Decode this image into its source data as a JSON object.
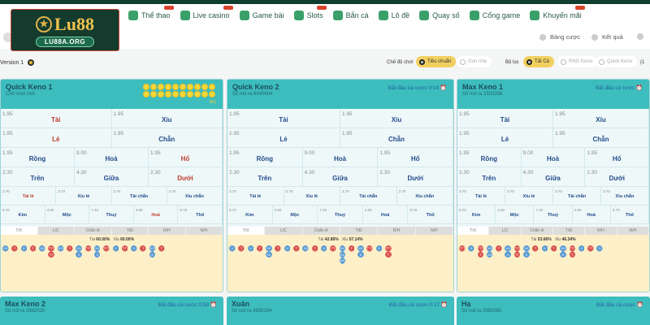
{
  "logo": {
    "text": "Lu88",
    "sub": "LU88A.ORG"
  },
  "nav": [
    {
      "label": "Thể thao",
      "badge": ""
    },
    {
      "label": "Live casino",
      "badge": ""
    },
    {
      "label": "Game bài",
      "badge": ""
    },
    {
      "label": "Slots",
      "badge": ""
    },
    {
      "label": "Bắn cá",
      "badge": ""
    },
    {
      "label": "Lô đề",
      "badge": ""
    },
    {
      "label": "Quay số",
      "badge": ""
    },
    {
      "label": "Cổng game",
      "badge": ""
    },
    {
      "label": "Khuyến mãi",
      "badge": ""
    }
  ],
  "sub": {
    "bet_board": "Bảng cược",
    "results": "Kết quả"
  },
  "filter": {
    "version": "Version 1",
    "mode_label": "Chế độ chơi",
    "modes": [
      "Tiêu chuẩn",
      "Gọn nhẹ"
    ],
    "filter_label": "Bộ lọc",
    "filters": [
      "Tất Cả",
      "RNG Keno",
      "Quick Keno"
    ],
    "extra": "(1"
  },
  "colors": {
    "header": "#3dbdbd",
    "tai": "#d9534f",
    "xiu": "#5b9bd5",
    "brand": "#143b2e"
  },
  "tabs": [
    "T/X",
    "L/C",
    "Chẵn lẻ",
    "T/Đ",
    "R/H",
    "N/H"
  ],
  "cards": [
    {
      "title": "Quick Keno 1",
      "subtitle": "Chờ lượt mới",
      "countdown": "",
      "sum": "903",
      "pct_tai_label": "Tài",
      "pct_tai": "60.00%",
      "pct_xiu_label": "Xỉu",
      "pct_xiu": "60.00%",
      "road": [
        "XX",
        "T",
        "X",
        "T",
        "XX",
        "TTTTT",
        "XX",
        "T",
        "XXX",
        "TTT",
        "XXX",
        "TTT",
        "X",
        "TT",
        "X",
        "T",
        "XXX",
        "T"
      ]
    },
    {
      "title": "Quick Keno 2",
      "subtitle": "Số nút ra 6490684",
      "countdown": "Bắt đầu cá cược 0:14",
      "pct_tai_label": "Tài",
      "pct_tai": "42.86%",
      "pct_xiu_label": "Xỉu",
      "pct_xiu": "57.14%",
      "road": [
        "X",
        "T",
        "X",
        "T",
        "XXXX",
        "T",
        "X",
        "T",
        "XX",
        "T",
        "X",
        "TT",
        "XXXXXX",
        "T",
        "XXX",
        "TTT",
        "X",
        "TTTT"
      ]
    },
    {
      "title": "Max Keno 1",
      "subtitle": "Số nút ra 3323356",
      "countdown": "Bắt đầu cá cược",
      "pct_tai_label": "Tài",
      "pct_tai": "53.66%",
      "pct_xiu_label": "Xỉu",
      "pct_xiu": "46.34%",
      "road": [
        "TTT",
        "X",
        "TTTT",
        "XXXX",
        "T",
        "XXX",
        "TTTTT",
        "XXX",
        "T",
        "X",
        "T",
        "XXX",
        "TTTT",
        "X",
        "TT",
        "X"
      ]
    }
  ],
  "odds": {
    "r1": [
      {
        "odd": "1.95",
        "label": "Tài"
      },
      {
        "odd": "1.95",
        "label": "Xỉu"
      }
    ],
    "r2": [
      {
        "odd": "1.95",
        "label": "Lẻ"
      },
      {
        "odd": "1.95",
        "label": "Chẵn"
      }
    ],
    "r3": [
      {
        "odd": "1.95",
        "label": "Rồng"
      },
      {
        "odd": "9.00",
        "label": "Hoà"
      },
      {
        "odd": "1.95",
        "label": "Hổ"
      }
    ],
    "r4": [
      {
        "odd": "2.30",
        "label": "Trên"
      },
      {
        "odd": "4.30",
        "label": "Giữa"
      },
      {
        "odd": "2.30",
        "label": "Dưới"
      }
    ],
    "r5": [
      {
        "odd": "3.70",
        "label": "Tài lẻ"
      },
      {
        "odd": "3.70",
        "label": "Xỉu lẻ"
      },
      {
        "odd": "3.70",
        "label": "Tài chẵn"
      },
      {
        "odd": "3.70",
        "label": "Xỉu chẵn"
      }
    ],
    "r6": [
      {
        "odd": "9.70",
        "label": "Kim"
      },
      {
        "odd": "4.60",
        "label": "Mộc"
      },
      {
        "odd": "7.40",
        "label": "Thuỷ"
      },
      {
        "odd": "4.60",
        "label": "Hoả"
      },
      {
        "odd": "9.70",
        "label": "Thổ"
      }
    ]
  },
  "bottom_cards": [
    {
      "title": "Max Keno 2",
      "subtitle": "Số nút ra 2682020",
      "countdown": "Bắt đầu cá cược 0:59"
    },
    {
      "title": "Xuân",
      "subtitle": "Số nút ra 4955194",
      "countdown": "Bắt đầu cá cược 0:17"
    },
    {
      "title": "Hạ",
      "subtitle": "Số nút ra 3983365",
      "countdown": "Bắt đầu cá cược"
    }
  ]
}
